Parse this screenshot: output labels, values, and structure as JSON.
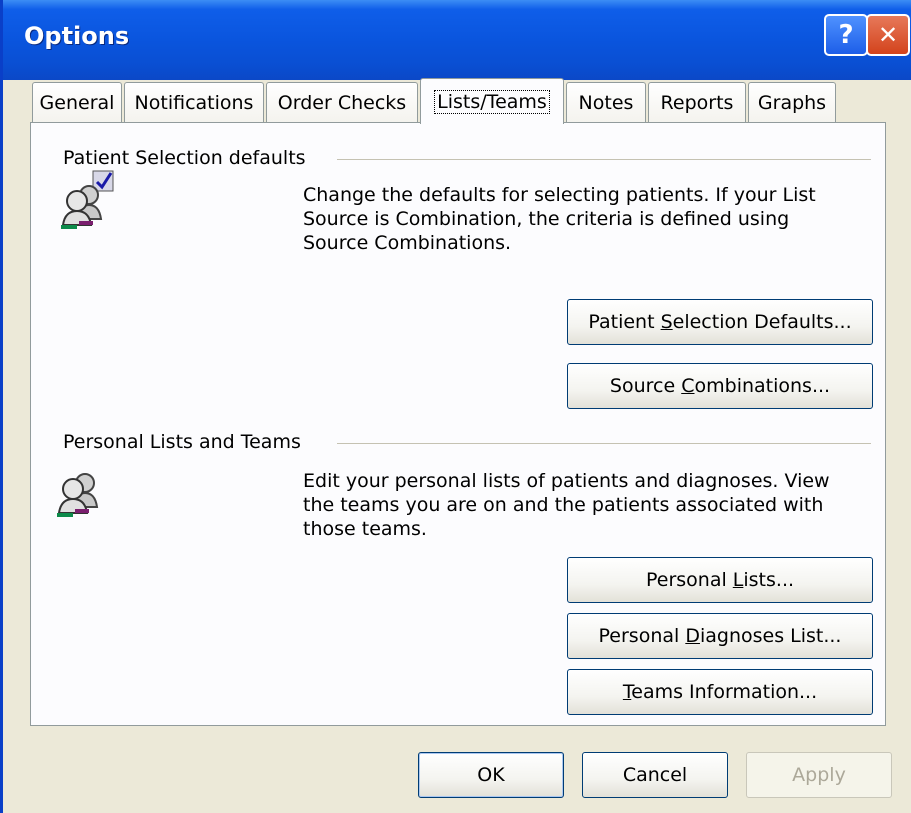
{
  "window": {
    "title": "Options",
    "help_button": "?",
    "close_button": "✕"
  },
  "tabs": [
    {
      "label": "General"
    },
    {
      "label": "Notifications"
    },
    {
      "label": "Order Checks"
    },
    {
      "label": "Lists/Teams"
    },
    {
      "label": "Notes"
    },
    {
      "label": "Reports"
    },
    {
      "label": "Graphs"
    }
  ],
  "active_tab": "Lists/Teams",
  "patient_selection": {
    "heading": "Patient Selection defaults",
    "description_lines": [
      "Change the defaults for selecting patients. If your List",
      "Source is Combination, the criteria is defined using",
      "Source Combinations."
    ],
    "buttons": [
      {
        "pre": "Patient ",
        "mnemonic": "S",
        "post": "election Defaults..."
      },
      {
        "pre": "Source ",
        "mnemonic": "C",
        "post": "ombinations..."
      }
    ],
    "icon": "patients-check-icon"
  },
  "personal_lists": {
    "heading": "Personal Lists and Teams",
    "description_lines": [
      "Edit your personal lists of patients and diagnoses. View",
      "the teams you are on and the patients associated with",
      "those teams."
    ],
    "buttons": [
      {
        "pre": "Personal ",
        "mnemonic": "L",
        "post": "ists..."
      },
      {
        "pre": "Personal ",
        "mnemonic": "D",
        "post": "iagnoses List..."
      },
      {
        "pre": "",
        "mnemonic": "T",
        "post": "eams Information..."
      }
    ],
    "icon": "patients-icon"
  },
  "footer": {
    "ok": "OK",
    "cancel": "Cancel",
    "apply": "Apply"
  },
  "colors": {
    "titlebar": "#0a55de",
    "dialog_bg": "#ece9d8",
    "panel_bg": "#fcfcfe"
  }
}
